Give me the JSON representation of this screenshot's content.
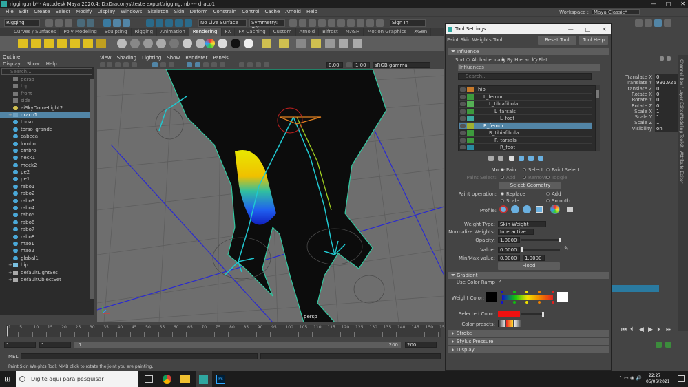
{
  "window": {
    "title": "rigging.mb* - Autodesk Maya 2020.4: D:\\Draconys\\teste export\\rigging.mb   ---   draco1",
    "controls": [
      "—",
      "□",
      "✕"
    ]
  },
  "menubar": {
    "items": [
      "File",
      "Edit",
      "Create",
      "Select",
      "Modify",
      "Display",
      "Windows",
      "Skeleton",
      "Skin",
      "Deform",
      "Constrain",
      "Control",
      "Cache",
      "Arnold",
      "Help"
    ],
    "workspace_label": "Workspace :",
    "workspace_value": "Maya Classic*"
  },
  "statusline": {
    "menuset": "Rigging",
    "live_surface": "No Live Surface",
    "symmetry": "Symmetry: Off",
    "signin": "Sign In"
  },
  "shelf": {
    "tabs": [
      "Curves / Surfaces",
      "Poly Modeling",
      "Sculpting",
      "Rigging",
      "Animation",
      "Rendering",
      "FX",
      "FX Caching",
      "Custom",
      "Arnold",
      "Bifrost",
      "MASH",
      "Motion Graphics",
      "XGen"
    ],
    "active_tab": "Rendering"
  },
  "outliner": {
    "title": "Outliner",
    "menu": [
      "Display",
      "Show",
      "Help"
    ],
    "search_placeholder": "Search...",
    "items": [
      {
        "label": "persp",
        "type": "camera"
      },
      {
        "label": "top",
        "type": "camera"
      },
      {
        "label": "front",
        "type": "camera"
      },
      {
        "label": "side",
        "type": "camera"
      },
      {
        "label": "aiSkyDomeLight2",
        "type": "light"
      },
      {
        "label": "draco1",
        "type": "mesh",
        "selected": true
      },
      {
        "label": "torso",
        "type": "curve"
      },
      {
        "label": "torso_grande",
        "type": "curve"
      },
      {
        "label": "cabeca",
        "type": "curve"
      },
      {
        "label": "lombo",
        "type": "curve"
      },
      {
        "label": "ombro",
        "type": "curve"
      },
      {
        "label": "neck1",
        "type": "curve"
      },
      {
        "label": "meck2",
        "type": "curve"
      },
      {
        "label": "pe2",
        "type": "curve"
      },
      {
        "label": "pe1",
        "type": "curve"
      },
      {
        "label": "rabo1",
        "type": "curve"
      },
      {
        "label": "rabo2",
        "type": "curve"
      },
      {
        "label": "rabo3",
        "type": "curve"
      },
      {
        "label": "rabo4",
        "type": "curve"
      },
      {
        "label": "rabo5",
        "type": "curve"
      },
      {
        "label": "rabo6",
        "type": "curve"
      },
      {
        "label": "rabo7",
        "type": "curve"
      },
      {
        "label": "rabo8",
        "type": "curve"
      },
      {
        "label": "mao1",
        "type": "curve"
      },
      {
        "label": "mao2",
        "type": "curve"
      },
      {
        "label": "global1",
        "type": "curve"
      },
      {
        "label": "hip",
        "type": "joint"
      },
      {
        "label": "defaultLightSet",
        "type": "set"
      },
      {
        "label": "defaultObjectSet",
        "type": "set"
      }
    ]
  },
  "viewport": {
    "menu": [
      "View",
      "Shading",
      "Lighting",
      "Show",
      "Renderer",
      "Panels"
    ],
    "field_a": "0.00",
    "field_b": "1.00",
    "colorspace": "sRGB gamma",
    "camera_label": "persp"
  },
  "timeslider": {
    "ticks": [
      "1",
      "5",
      "10",
      "15",
      "20",
      "25",
      "30",
      "35",
      "40",
      "45",
      "50",
      "55",
      "60",
      "65",
      "70",
      "75",
      "80",
      "85",
      "90",
      "95",
      "100",
      "105",
      "110",
      "115",
      "120",
      "125",
      "130",
      "135",
      "140",
      "145",
      "150",
      "155"
    ],
    "current_frame": "1"
  },
  "rangebar": {
    "start": "1",
    "start_inner": "1",
    "range_start_label": "1",
    "range_end_label": "200",
    "end_inner": "200",
    "end": "200"
  },
  "mel": {
    "label": "MEL"
  },
  "helpline": "Paint Skin Weights Tool: MMB click to rotate the joint you are painting.",
  "tool_settings": {
    "window_title": "Tool Settings",
    "tool_name": "Paint Skin Weights Tool",
    "reset_button": "Reset Tool",
    "help_button": "Tool Help",
    "influence_section": "Influence",
    "sort_label": "Sort:",
    "sort_options": [
      "Alphabetically",
      "By Hierarchy",
      "Flat"
    ],
    "sort_selected": "By Hierarchy",
    "influences_label": "Influences",
    "search_placeholder": "Search...",
    "influences": [
      {
        "label": "hip",
        "indent": 0,
        "color": "#c87a2a"
      },
      {
        "label": "L_femur",
        "indent": 1,
        "color": "#3d9a3d"
      },
      {
        "label": "L_tibiafibula",
        "indent": 2,
        "color": "#55b055"
      },
      {
        "label": "L_tarsals",
        "indent": 3,
        "color": "#3d9a3d"
      },
      {
        "label": "L_foot",
        "indent": 4,
        "color": "#3daaa0"
      },
      {
        "label": "R_femur",
        "indent": 1,
        "color": "#a0b030",
        "selected": true
      },
      {
        "label": "R_tibiafibula",
        "indent": 2,
        "color": "#3d9a3d"
      },
      {
        "label": "R_tarsals",
        "indent": 3,
        "color": "#3d9a3d"
      },
      {
        "label": "R_foot",
        "indent": 4,
        "color": "#2a8aa0"
      }
    ],
    "mode_label": "Mode:",
    "mode_options": [
      "Paint",
      "Select",
      "Paint Select"
    ],
    "paint_select_label": "Paint Select:",
    "paint_select_options": [
      "Add",
      "Remove",
      "Toggle"
    ],
    "select_geometry_button": "Select Geometry",
    "paint_operation_label": "Paint operation:",
    "paint_operations": [
      "Replace",
      "Add",
      "Scale",
      "Smooth"
    ],
    "paint_operation_selected": "Replace",
    "profile_label": "Profile:",
    "weight_type_label": "Weight Type:",
    "weight_type_value": "Skin Weight",
    "normalize_label": "Normalize Weights:",
    "normalize_value": "Interactive",
    "opacity_label": "Opacity:",
    "opacity_value": "1.0000",
    "value_label": "Value:",
    "value_value": "0.0000",
    "minmax_label": "Min/Max value:",
    "min_value": "0.0000",
    "max_value": "1.0000",
    "flood_button": "Flood",
    "gradient_section": "Gradient",
    "use_color_ramp_label": "Use Color Ramp",
    "weight_color_label": "Weight Color:",
    "selected_color_label": "Selected Color:",
    "color_presets_label": "Color presets:",
    "stroke_section": "Stroke",
    "stylus_section": "Stylus Pressure",
    "display_section": "Display"
  },
  "channelbox": {
    "attributes": [
      {
        "label": "Translate X",
        "value": "0"
      },
      {
        "label": "Translate Y",
        "value": "991.926"
      },
      {
        "label": "Translate Z",
        "value": "0"
      },
      {
        "label": "Rotate X",
        "value": "0"
      },
      {
        "label": "Rotate Y",
        "value": "0"
      },
      {
        "label": "Rotate Z",
        "value": "0"
      },
      {
        "label": "Scale X",
        "value": "1"
      },
      {
        "label": "Scale Y",
        "value": "1"
      },
      {
        "label": "Scale Z",
        "value": "1"
      },
      {
        "label": "Visibility",
        "value": "on"
      }
    ],
    "side_tabs": [
      "Channel Box / Layer Editor",
      "Modeling Toolkit",
      "Attribute Editor"
    ]
  },
  "taskbar": {
    "search_placeholder": "Digite aqui para pesquisar",
    "time": "22:27",
    "date": "05/06/2021"
  },
  "colors": {
    "maya_panel": "#444444",
    "maya_dark": "#2b2b2b",
    "selection_blue": "#5285a6",
    "viewport_bg": "#6e6e6e"
  }
}
